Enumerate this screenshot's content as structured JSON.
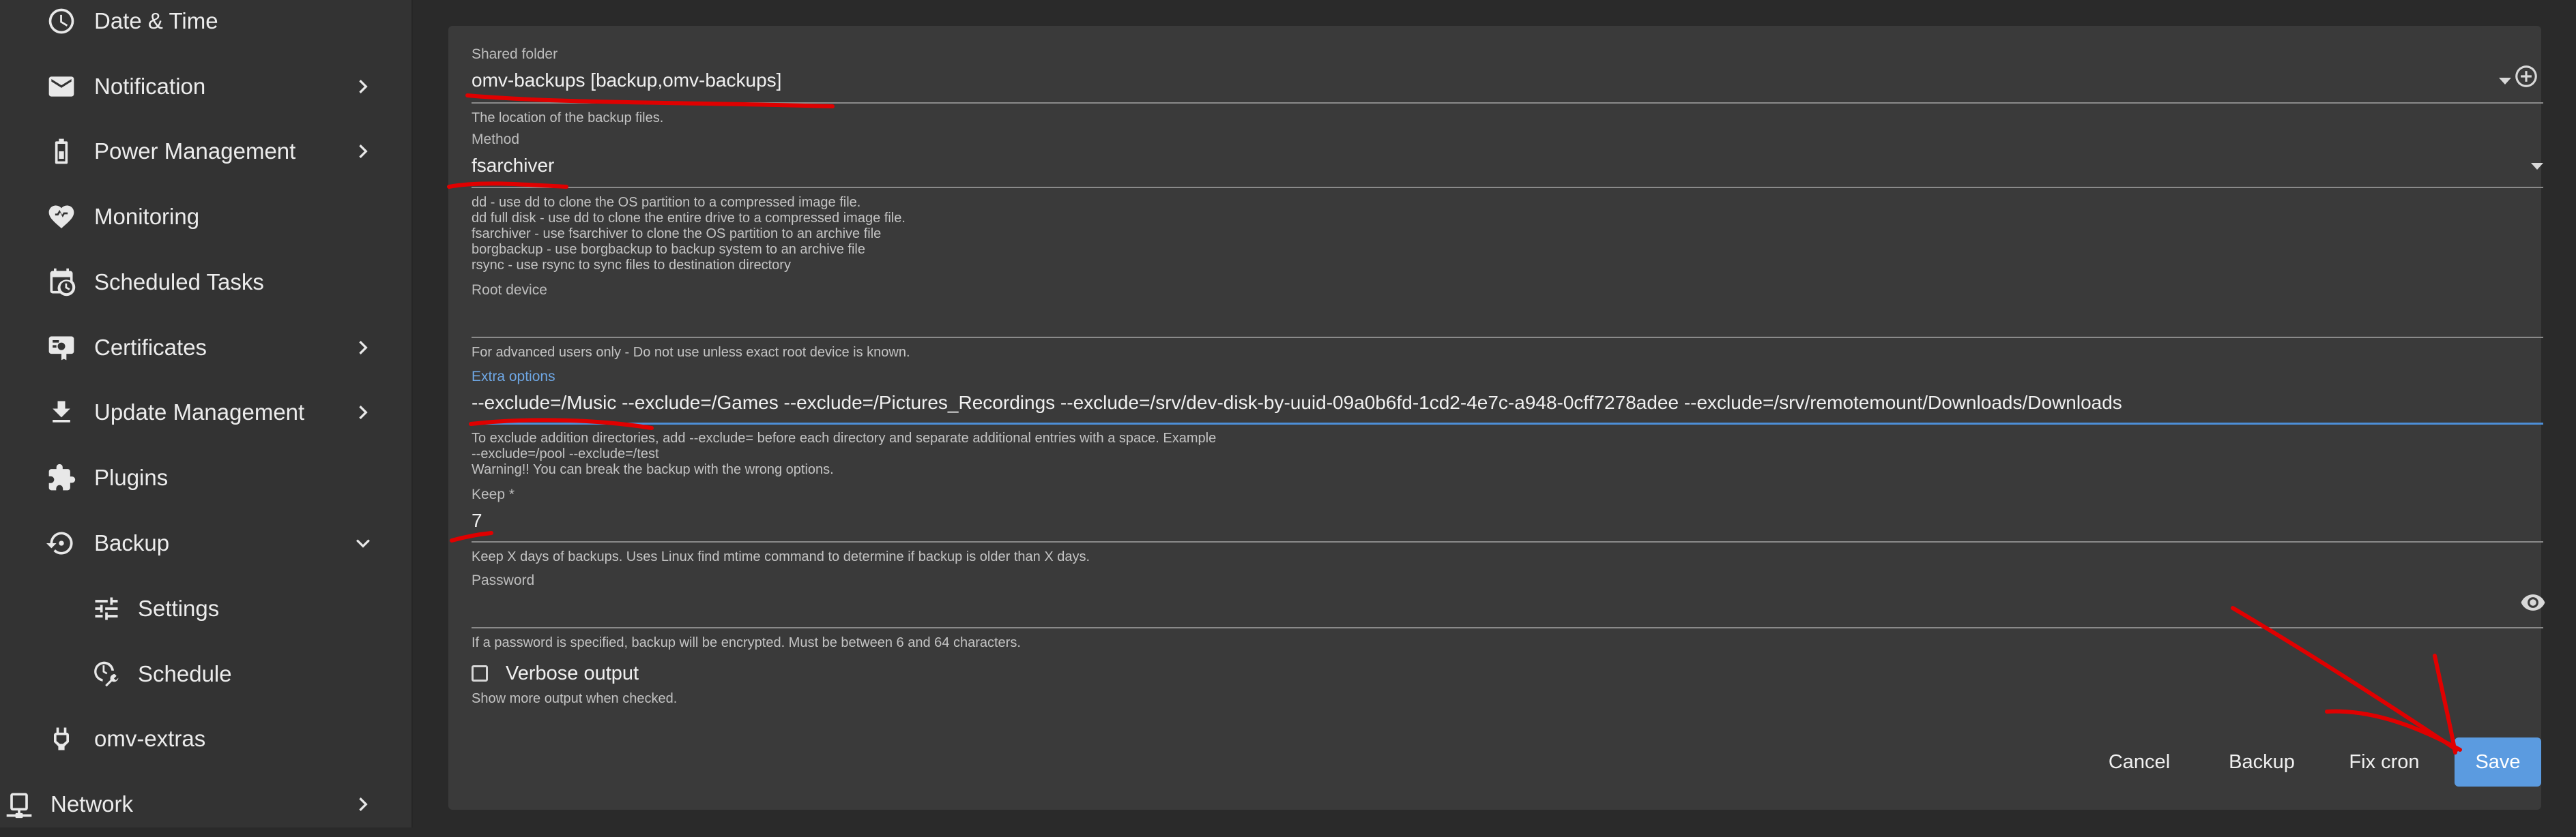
{
  "sidebar": {
    "items": [
      {
        "label": "Date & Time",
        "icon": "clock-icon"
      },
      {
        "label": "Notification",
        "icon": "mail-icon",
        "chevron": "right"
      },
      {
        "label": "Power Management",
        "icon": "battery-icon",
        "chevron": "right"
      },
      {
        "label": "Monitoring",
        "icon": "heart-pulse-icon"
      },
      {
        "label": "Scheduled Tasks",
        "icon": "calendar-clock-icon"
      },
      {
        "label": "Certificates",
        "icon": "certificate-icon",
        "chevron": "right"
      },
      {
        "label": "Update Management",
        "icon": "download-icon",
        "chevron": "right"
      },
      {
        "label": "Plugins",
        "icon": "puzzle-icon"
      },
      {
        "label": "Backup",
        "icon": "backup-restore-icon",
        "chevron": "down"
      },
      {
        "label": "Settings",
        "icon": "tune-icon",
        "sub": true
      },
      {
        "label": "Schedule",
        "icon": "clock-wrench-icon",
        "sub": true
      },
      {
        "label": "omv-extras",
        "icon": "plug-icon"
      },
      {
        "label": "Network",
        "icon": "network-icon",
        "chevron": "right"
      }
    ]
  },
  "form": {
    "shared_folder": {
      "label": "Shared folder",
      "value": "omv-backups [backup,omv-backups]",
      "hint": "The location of the backup files."
    },
    "method": {
      "label": "Method",
      "value": "fsarchiver",
      "hints": [
        "dd - use dd to clone the OS partition to a compressed image file.",
        "dd full disk - use dd to clone the entire drive to a compressed image file.",
        "fsarchiver - use fsarchiver to clone the OS partition to an archive file",
        "borgbackup - use borgbackup to backup system to an archive file",
        "rsync - use rsync to sync files to destination directory"
      ]
    },
    "root_device": {
      "label": "Root device",
      "value": "",
      "hint": "For advanced users only - Do not use unless exact root device is known."
    },
    "extra_options": {
      "label": "Extra options",
      "value": "--exclude=/Music --exclude=/Games --exclude=/Pictures_Recordings  --exclude=/srv/dev-disk-by-uuid-09a0b6fd-1cd2-4e7c-a948-0cff7278adee --exclude=/srv/remotemount/Downloads/Downloads",
      "hints": [
        "To exclude addition directories, add --exclude= before each directory and separate additional entries with a space. Example",
        "--exclude=/pool --exclude=/test",
        "Warning!! You can break the backup with the wrong options."
      ]
    },
    "keep": {
      "label": "Keep *",
      "value": "7",
      "hint": "Keep X days of backups. Uses Linux find mtime command to determine if backup is older than X days."
    },
    "password": {
      "label": "Password",
      "value": "",
      "hint": "If a password is specified, backup will be encrypted. Must be between 6 and 64 characters."
    },
    "verbose": {
      "label": "Verbose output",
      "checked": false,
      "hint": "Show more output when checked."
    }
  },
  "actions": {
    "cancel": "Cancel",
    "backup": "Backup",
    "fix_cron": "Fix cron",
    "save": "Save"
  },
  "colors": {
    "accent": "#5b9be0",
    "annotation": "#e00000"
  }
}
